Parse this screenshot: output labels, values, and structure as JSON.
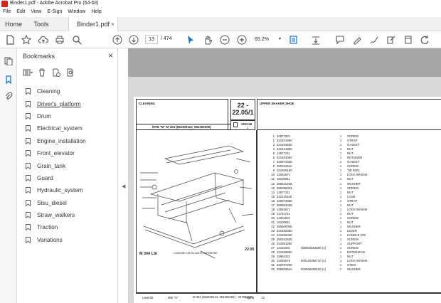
{
  "window": {
    "title": "Binder1.pdf - Adobe Acrobat Pro (64-bit)"
  },
  "menu": [
    "File",
    "Edit",
    "View",
    "E-Sign",
    "Window",
    "Help"
  ],
  "tabs": {
    "home": "Home",
    "tools": "Tools",
    "document": "Binder1.pdf",
    "close": "×"
  },
  "toolbar": {
    "current_page": "13",
    "page_total": "/  474",
    "zoom": "65.2%"
  },
  "bookmarks": {
    "header": "Bookmarks",
    "close": "×",
    "items": [
      "Cleaning",
      "Driver's_platform",
      "Drum",
      "Electrical_system",
      "Engine_installation",
      "Front_elevator",
      "Grain_tank",
      "Guard",
      "Hydraulic_system",
      "Sisu_diesel",
      "Straw_walkers",
      "Traction",
      "Variations"
    ],
    "active_index": 1
  },
  "page": {
    "section": "CLEANING",
    "ref_top": "22 -",
    "ref_num": "22.05/1",
    "model_line": "MTB \"M\" M 304 (552300124_552300208)",
    "ref_small": "2222.05",
    "ref_small2": "1",
    "title": "UPPER SHAKER SHOE",
    "drawing_label": "M 304 LSI",
    "drawing_caption": "CASSONE CRIVELLANTE SUPERIORE",
    "drawing_ref": "22.05",
    "footer": {
      "brand": "Laverda",
      "mtb": "Mtb \"m\"",
      "model": "M 304 (552300124, 552300208) - 327971600",
      "page_label": "Pagina",
      "page_no": "13"
    },
    "parts": [
      {
        "n": "1",
        "code": "10977821",
        "extra": "",
        "qty": "1",
        "desc": "SCREW"
      },
      {
        "n": "2",
        "code": "322201960",
        "extra": "",
        "qty": "1",
        "desc": "STRAP"
      },
      {
        "n": "3",
        "code": "321834650",
        "extra": "",
        "qty": "1",
        "desc": "GASKET"
      },
      {
        "n": "4",
        "code": "322121950",
        "extra": "",
        "qty": "1",
        "desc": "NUT"
      },
      {
        "n": "5",
        "code": "12577211",
        "extra": "",
        "qty": "1",
        "desc": "NUT"
      },
      {
        "n": "6",
        "code": "321833050",
        "extra": "",
        "qty": "1",
        "desc": "RETAINER"
      },
      {
        "n": "7",
        "code": "320973450",
        "extra": "",
        "qty": "1",
        "desc": "GASKET"
      },
      {
        "n": "8",
        "code": "350342511",
        "extra": "",
        "qty": "1",
        "desc": "SCREW"
      },
      {
        "n": "9",
        "code": "321836150",
        "extra": "",
        "qty": "1",
        "desc": "TIE ROD"
      },
      {
        "n": "10",
        "code": "12054671",
        "extra": "",
        "qty": "1",
        "desc": "LOCK WASHE"
      },
      {
        "n": "11",
        "code": "16100811",
        "extra": "",
        "qty": "1",
        "desc": "NUT"
      },
      {
        "n": "12",
        "code": "355511030",
        "extra": "",
        "qty": "1",
        "desc": "WASHER"
      },
      {
        "n": "13",
        "code": "350396004",
        "extra": "",
        "qty": "1",
        "desc": "SPRING"
      },
      {
        "n": "14",
        "code": "12577211",
        "extra": "",
        "qty": "1",
        "desc": "NUT"
      },
      {
        "n": "15",
        "code": "322115150",
        "extra": "",
        "qty": "1",
        "desc": "CASE"
      },
      {
        "n": "16",
        "code": "320972850",
        "extra": "",
        "qty": "1",
        "desc": "STRAP"
      },
      {
        "n": "17",
        "code": "360653408",
        "extra": "",
        "qty": "1",
        "desc": "NUT"
      },
      {
        "n": "18",
        "code": "12054671",
        "extra": "",
        "qty": "1",
        "desc": "LOCK WASHE"
      },
      {
        "n": "19",
        "code": "11701721",
        "extra": "",
        "qty": "1",
        "desc": "NUT"
      },
      {
        "n": "20",
        "code": "14301821",
        "extra": "",
        "qty": "1",
        "desc": "SCREW"
      },
      {
        "n": "21",
        "code": "16100811",
        "extra": "",
        "qty": "1",
        "desc": "NUT"
      },
      {
        "n": "22",
        "code": "355500005",
        "extra": "",
        "qty": "1",
        "desc": "WASHER"
      },
      {
        "n": "23",
        "code": "321835350",
        "extra": "",
        "qty": "1",
        "desc": "LEVER"
      },
      {
        "n": "24",
        "code": "321835450",
        "extra": "",
        "qty": "1",
        "desc": "HANDLE GRI"
      },
      {
        "n": "25",
        "code": "350342525",
        "extra": "",
        "qty": "1",
        "desc": "SCREW"
      },
      {
        "n": "26",
        "code": "321881250",
        "extra": "",
        "qty": "1",
        "desc": "SUPPORT"
      },
      {
        "n": "27",
        "code": "13184001",
        "extra": "000803504590 (1)",
        "qty": "1",
        "desc": "SCREW"
      },
      {
        "n": "28",
        "code": "321835850",
        "extra": "",
        "qty": "1",
        "desc": "EXTENSION"
      },
      {
        "n": "29",
        "code": "15884221",
        "extra": "",
        "qty": "1",
        "desc": "NUT"
      },
      {
        "n": "30",
        "code": "12035670",
        "extra": "000120356710 (1)",
        "qty": "1",
        "desc": "LOCK WASHE"
      },
      {
        "n": "31",
        "code": "320797250",
        "extra": "",
        "qty": "1",
        "desc": "STEM"
      },
      {
        "n": "32",
        "code": "355500610",
        "extra": "003555006150 (1)",
        "qty": "1",
        "desc": "WASHER"
      }
    ]
  }
}
